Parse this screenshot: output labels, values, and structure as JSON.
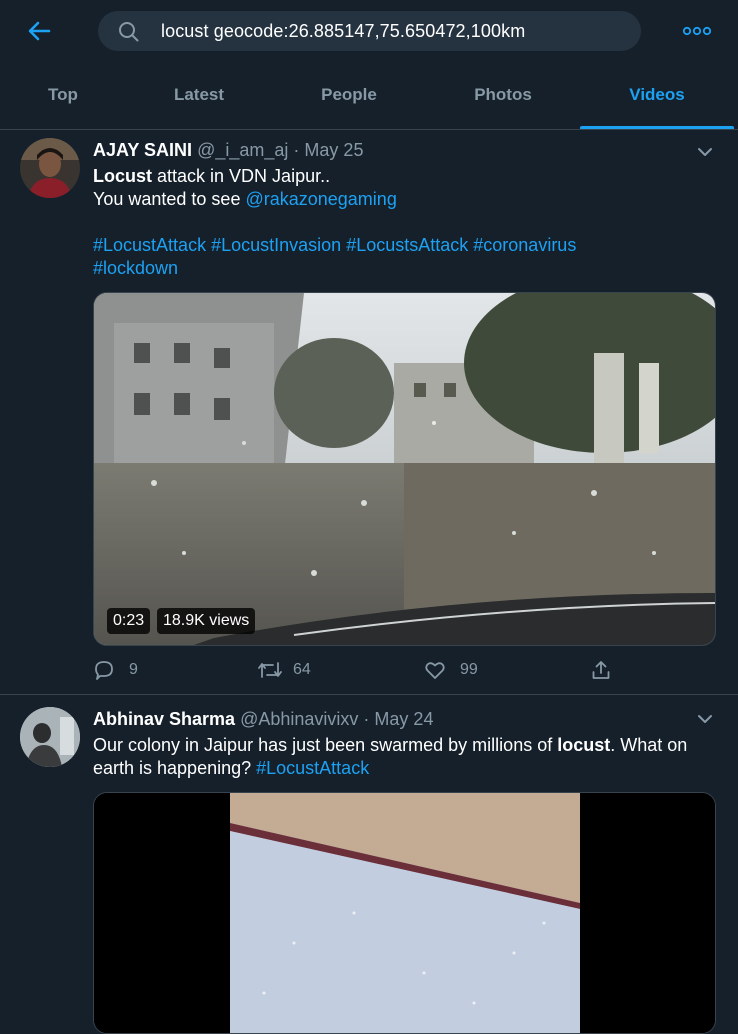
{
  "search": {
    "query": "locust geocode:26.885147,75.650472,100km"
  },
  "tabs": [
    {
      "label": "Top"
    },
    {
      "label": "Latest"
    },
    {
      "label": "People"
    },
    {
      "label": "Photos"
    },
    {
      "label": "Videos",
      "active": true
    }
  ],
  "tweets": [
    {
      "display_name": "AJAY SAINI",
      "handle": "@_i_am_aj",
      "separator": "·",
      "date": "May 25",
      "text_bold": "Locust",
      "text_line1_rest": " attack in VDN Jaipur..",
      "text_line2": "You wanted to see ",
      "mention": "@rakazonegaming",
      "hashtags": [
        "#LocustAttack",
        "#LocustInvasion",
        "#LocustsAttack",
        "#coronavirus",
        "#lockdown"
      ],
      "video": {
        "duration": "0:23",
        "views": "18.9K views"
      },
      "stats": {
        "replies": "9",
        "retweets": "64",
        "likes": "99"
      }
    },
    {
      "display_name": "Abhinav Sharma",
      "handle": "@Abhinavivixv",
      "separator": "·",
      "date": "May 24",
      "text_part1": "Our colony in Jaipur has just been swarmed by millions of ",
      "text_bold": "locust",
      "text_part2": ". What on earth is happening? ",
      "hashtag": "#LocustAttack"
    }
  ],
  "colors": {
    "background": "#15202b",
    "accent": "#1da1f2",
    "secondary_text": "#8899a6",
    "border": "#38444d"
  }
}
